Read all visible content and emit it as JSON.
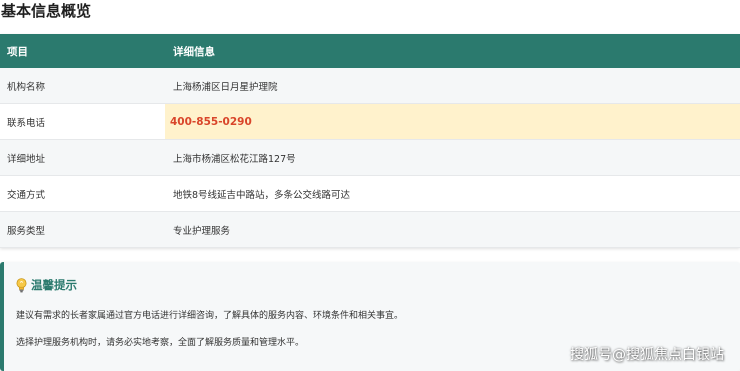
{
  "page": {
    "title": "基本信息概览"
  },
  "table": {
    "headers": [
      "项目",
      "详细信息"
    ],
    "rows": [
      {
        "label": "机构名称",
        "value": "上海杨浦区日月星护理院"
      },
      {
        "label": "联系电话",
        "value": "400-855-0290"
      },
      {
        "label": "详细地址",
        "value": "上海市杨浦区松花江路127号"
      },
      {
        "label": "交通方式",
        "value": "地铁8号线延吉中路站，多条公交线路可达"
      },
      {
        "label": "服务类型",
        "value": "专业护理服务"
      }
    ]
  },
  "tip": {
    "icon": "lightbulb-icon",
    "title": "温馨提示",
    "lines": [
      "建议有需求的长者家属通过官方电话进行详细咨询，了解具体的服务内容、环境条件和相关事宜。",
      "选择护理服务机构时，请务必实地考察，全面了解服务质量和管理水平。"
    ]
  },
  "watermark": {
    "text": "搜狐号@搜狐焦点白银站"
  },
  "colors": {
    "header_bg": "#2b7a6e",
    "phone_highlight_bg": "#fff2cc",
    "phone_text": "#d9452a",
    "tip_title": "#2b7a6e"
  }
}
